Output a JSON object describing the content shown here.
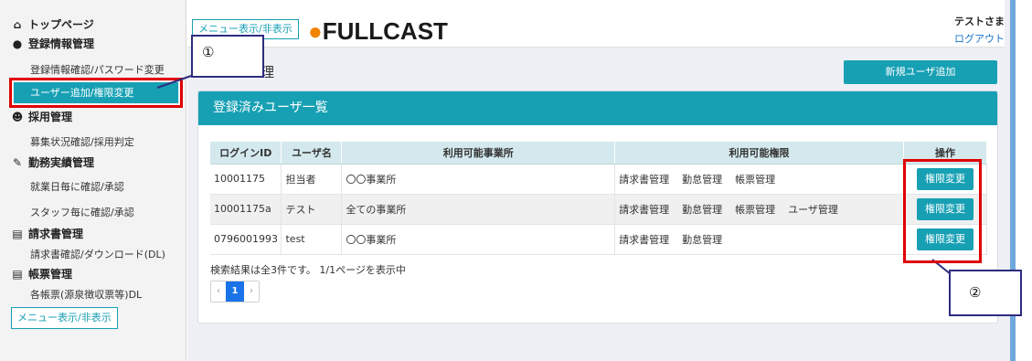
{
  "sidebar": {
    "top_page": "トップページ",
    "sections": [
      {
        "heading": "登録情報管理",
        "items": [
          "登録情報確認/パスワード変更",
          "ユーザー追加/権限変更"
        ]
      },
      {
        "heading": "採用管理",
        "items": [
          "募集状況確認/採用判定"
        ]
      },
      {
        "heading": "勤務実績管理",
        "items": [
          "就業日毎に確認/承認",
          "スタッフ毎に確認/承認"
        ]
      },
      {
        "heading": "請求書管理",
        "items": [
          "請求書確認/ダウンロード(DL)"
        ]
      },
      {
        "heading": "帳票管理",
        "items": [
          "各帳票(源泉徴収票等)DL"
        ]
      }
    ],
    "menu_toggle": "メニュー表示/非表示"
  },
  "header": {
    "menu_toggle": "メニュー表示/非表示",
    "logo_text": "FULLCAST",
    "user_name": "テストさま",
    "logout": "ログアウト",
    "page_title_fragment": "理"
  },
  "main": {
    "add_user_button": "新規ユーザ追加",
    "panel_title": "登録済みユーザ一覧",
    "columns": [
      "ログインID",
      "ユーザ名",
      "利用可能事業所",
      "利用可能権限",
      "操作"
    ],
    "rows": [
      {
        "login_id": "10001175",
        "user_name": "担当者",
        "office": "〇〇事業所",
        "permissions": [
          "請求書管理",
          "勤怠管理",
          "帳票管理"
        ],
        "action": "権限変更"
      },
      {
        "login_id": "10001175a",
        "user_name": "テスト",
        "office": "全ての事業所",
        "permissions": [
          "請求書管理",
          "勤怠管理",
          "帳票管理",
          "ユーザ管理"
        ],
        "action": "権限変更"
      },
      {
        "login_id": "0796001993",
        "user_name": "test",
        "office": "〇〇事業所",
        "permissions": [
          "請求書管理",
          "勤怠管理"
        ],
        "action": "権限変更"
      }
    ],
    "result_text": "検索結果は全3件です。 1/1ページを表示中",
    "pager": {
      "prev": "‹",
      "current": "1",
      "next": "›"
    }
  },
  "annotations": {
    "callout_1": "①",
    "callout_2": "②"
  },
  "colors": {
    "accent": "#17a0b4",
    "highlight": "#e00000",
    "callout_border": "#2e2c80"
  }
}
